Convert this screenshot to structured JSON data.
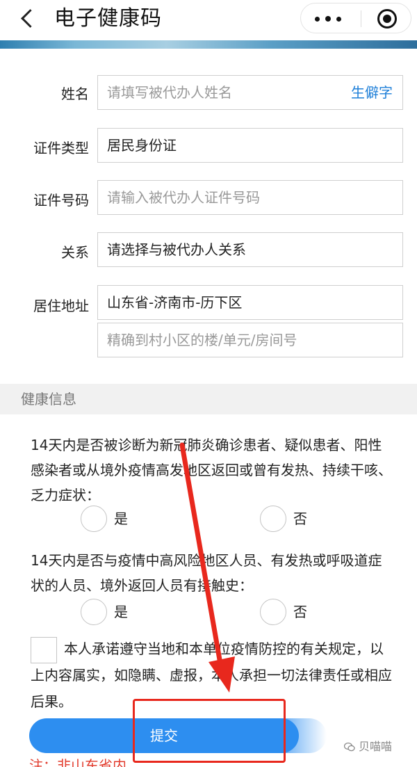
{
  "navbar": {
    "title": "电子健康码"
  },
  "form": {
    "name": {
      "label": "姓名",
      "placeholder": "请填写被代办人姓名",
      "rare_char_link": "生僻字"
    },
    "id_type": {
      "label": "证件类型",
      "value": "居民身份证"
    },
    "id_number": {
      "label": "证件号码",
      "placeholder": "请输入被代办人证件号码"
    },
    "relation": {
      "label": "关系",
      "value": "请选择与被代办人关系"
    },
    "address": {
      "label": "居住地址",
      "value": "山东省-济南市-历下区",
      "detail_placeholder": "精确到村小区的楼/单元/房间号"
    }
  },
  "health": {
    "section_title": "健康信息",
    "q1": {
      "text": "14天内是否被诊断为新冠肺炎确诊患者、疑似患者、阳性感染者或从境外疫情高发地区返回或曾有发热、持续干咳、乏力症状：",
      "yes": "是",
      "no": "否"
    },
    "q2": {
      "text": "14天内是否与疫情中高风险地区人员、有发热或呼吸道症状的人员、境外返回人员有接触史：",
      "yes": "是",
      "no": "否"
    },
    "promise": "本人承诺遵守当地和本单位疫情防控的有关规定，以上内容属实，如隐瞒、虚报，本人承担一切法律责任或相应后果。"
  },
  "submit_label": "提交",
  "note": "注：非山东省内…",
  "watermark": "贝喵喵",
  "colors": {
    "accent": "#2d8ef0",
    "link": "#1e7fd8",
    "annotation": "#e8281d"
  },
  "icons": [
    "back-arrow-icon",
    "more-dots-icon",
    "close-mini-program-icon",
    "wechat-watermark-icon"
  ]
}
